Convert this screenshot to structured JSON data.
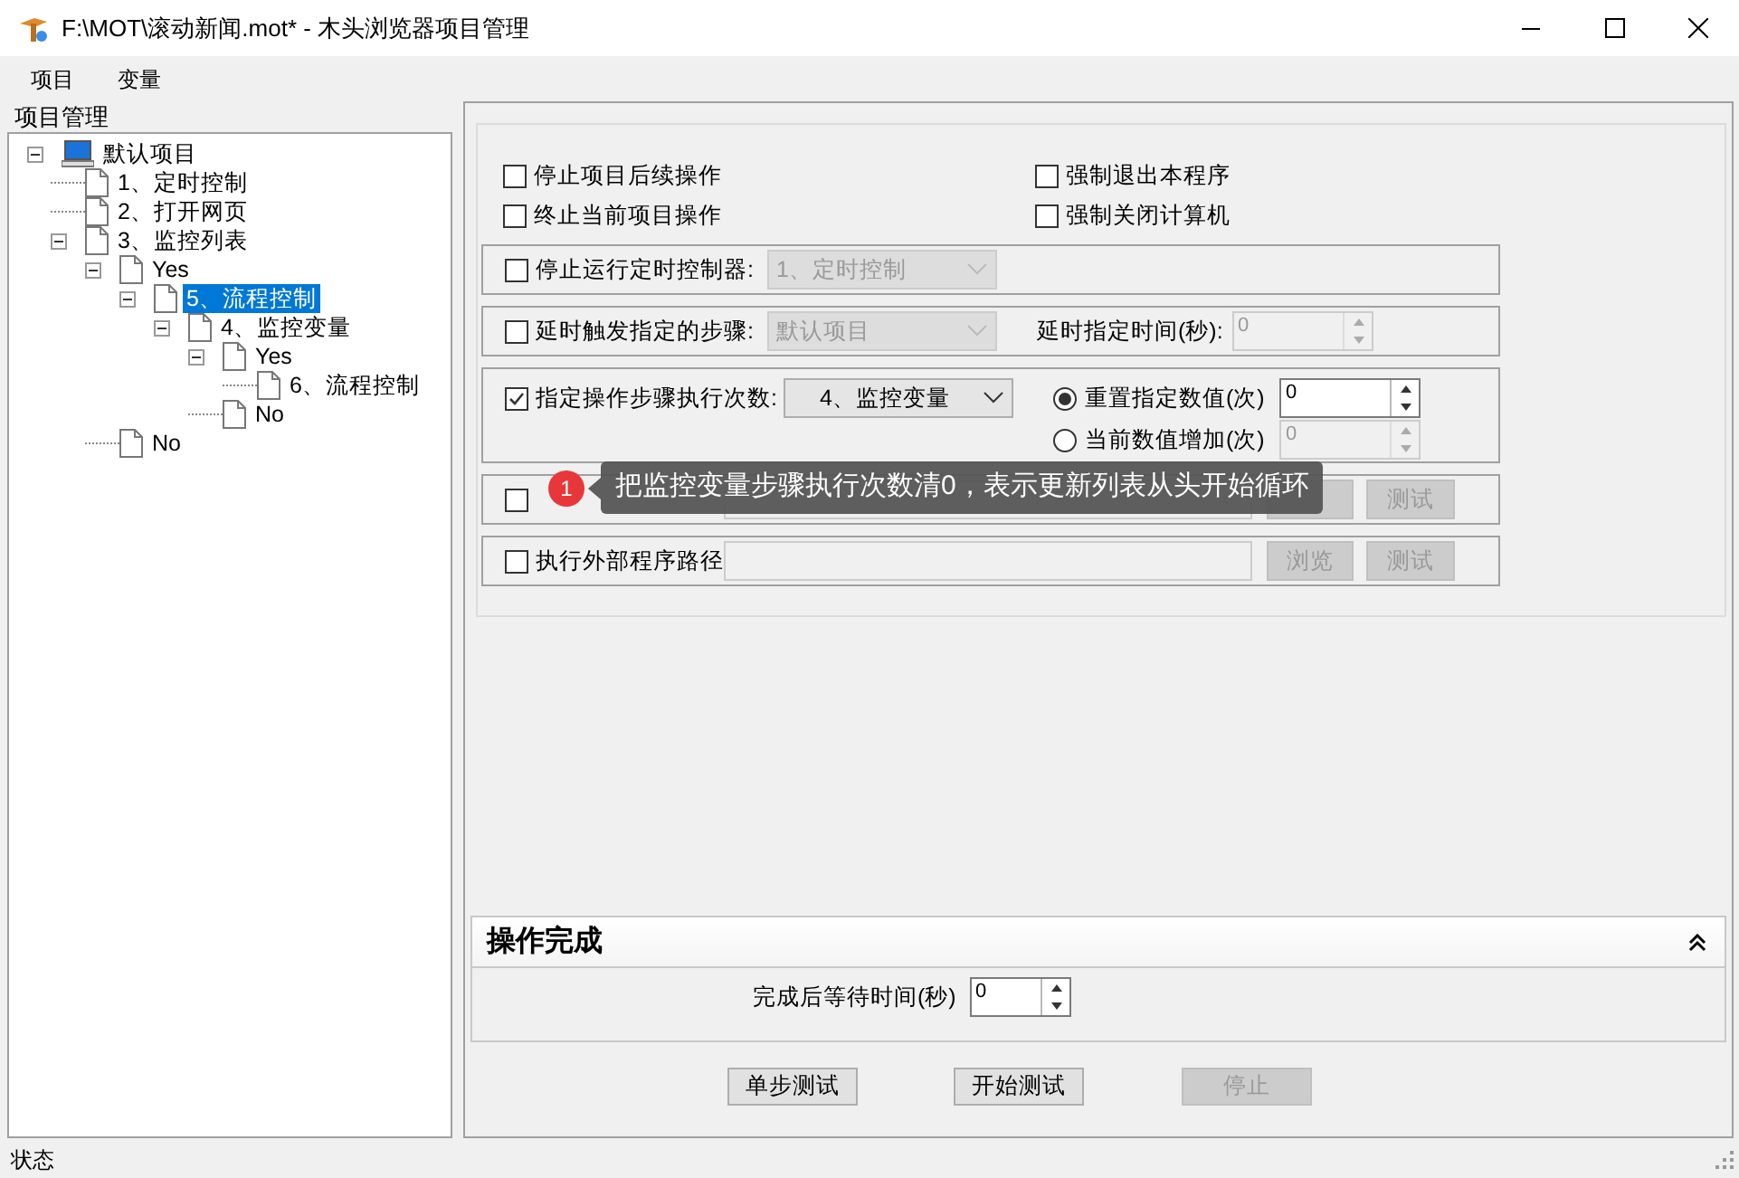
{
  "window": {
    "title": "F:\\MOT\\滚动新闻.mot* - 木头浏览器项目管理"
  },
  "menu": [
    "项目",
    "变量"
  ],
  "project_panel": {
    "title": "项目管理",
    "tree": {
      "label": "默认项目",
      "kind": "computer",
      "expanded": true,
      "selected": false,
      "children": [
        {
          "label": "1、定时控制",
          "kind": "page",
          "selected": false
        },
        {
          "label": "2、打开网页",
          "kind": "page",
          "selected": false
        },
        {
          "label": "3、监控列表",
          "kind": "page",
          "expanded": true,
          "selected": false,
          "children": [
            {
              "label": "Yes",
              "kind": "page",
              "expanded": true,
              "selected": false,
              "children": [
                {
                  "label": "5、流程控制",
                  "kind": "page",
                  "expanded": true,
                  "selected": true,
                  "children": [
                    {
                      "label": "4、监控变量",
                      "kind": "page",
                      "expanded": true,
                      "selected": false,
                      "children": [
                        {
                          "label": "Yes",
                          "kind": "page",
                          "expanded": true,
                          "selected": false,
                          "children": [
                            {
                              "label": "6、流程控制",
                              "kind": "page",
                              "selected": false
                            }
                          ]
                        },
                        {
                          "label": "No",
                          "kind": "page",
                          "selected": false
                        }
                      ]
                    }
                  ]
                }
              ]
            },
            {
              "label": "No",
              "kind": "page",
              "selected": false
            }
          ]
        }
      ]
    }
  },
  "options": [
    {
      "label": "停止项目后续操作",
      "checked": false
    },
    {
      "label": "强制退出本程序",
      "checked": false
    },
    {
      "label": "终止当前项目操作",
      "checked": false
    },
    {
      "label": "强制关闭计算机",
      "checked": false
    }
  ],
  "groups": [
    {
      "kind": "select",
      "checkbox": {
        "label": "停止运行定时控制器:",
        "checked": false
      },
      "select": {
        "value": "1、定时控制",
        "disabled": true
      }
    },
    {
      "kind": "select_delay",
      "checkbox": {
        "label": "延时触发指定的步骤:",
        "checked": false
      },
      "select": {
        "value": "默认项目",
        "disabled": true
      },
      "delay_label": "延时指定时间(秒):",
      "delay_spin": {
        "value": "0",
        "disabled": true
      }
    },
    {
      "kind": "count",
      "checkbox": {
        "label": "指定操作步骤执行次数:",
        "checked": true
      },
      "select": {
        "value": "4、监控变量",
        "disabled": false
      },
      "radios": [
        {
          "label": "重置指定数值(次)",
          "selected": true,
          "spin": {
            "value": "0",
            "disabled": false
          }
        },
        {
          "label": "当前数值增加(次)",
          "selected": false,
          "spin": {
            "value": "0",
            "disabled": true
          }
        }
      ]
    },
    {
      "kind": "path",
      "checkbox": {
        "checked": false
      },
      "browse": {
        "disabled": true
      },
      "test": {
        "label": "测试",
        "disabled": true
      }
    },
    {
      "kind": "path",
      "checkbox": {
        "label": "执行外部程序路径",
        "checked": false
      },
      "browse": {
        "label": "浏览",
        "disabled": true
      },
      "test": {
        "label": "测试",
        "disabled": true
      }
    }
  ],
  "tooltip": {
    "badge": "1",
    "text": "把监控变量步骤执行次数清0，表示更新列表从头开始循环"
  },
  "finish_section": {
    "title": "操作完成",
    "expanded": true,
    "wait_label": "完成后等待时间(秒)",
    "wait_spin": {
      "value": "0",
      "disabled": false
    }
  },
  "buttons": [
    {
      "label": "单步测试",
      "disabled": false
    },
    {
      "label": "开始测试",
      "disabled": false
    },
    {
      "label": "停止",
      "disabled": true
    }
  ],
  "status_bar": "状态"
}
